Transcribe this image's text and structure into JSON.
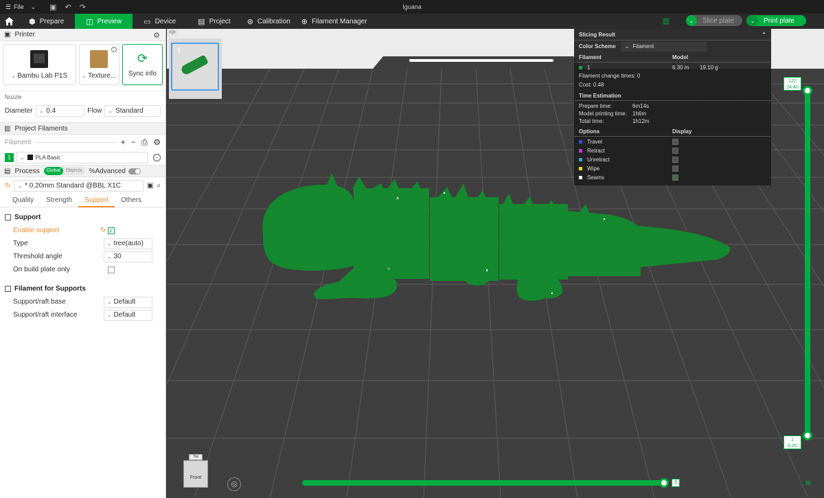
{
  "titlebar": {
    "file_label": "File",
    "title": "Iguana"
  },
  "menubar": {
    "tabs": [
      {
        "label": "Prepare"
      },
      {
        "label": "Preview"
      },
      {
        "label": "Device"
      },
      {
        "label": "Project"
      },
      {
        "label": "Calibration"
      },
      {
        "label": "Filament Manager"
      }
    ],
    "active_tab": "Preview",
    "slice_label": "Slice plate",
    "print_label": "Print plate"
  },
  "colors": {
    "accent": "#00ae42",
    "modified": "#f08c2a",
    "model": "#14892f"
  },
  "printer": {
    "section_title": "Printer",
    "printer_name": "Bambu Lab P1S",
    "plate_name": "Texture...",
    "sync_label": "Sync info",
    "nozzle_label": "Nozzle",
    "diameter_label": "Diameter",
    "diameter_value": "0.4",
    "flow_label": "Flow",
    "flow_value": "Standard"
  },
  "filaments": {
    "section_title": "Project Filaments",
    "filament_label": "Filament",
    "items": [
      {
        "index": "1",
        "name": "PLA Basic"
      }
    ]
  },
  "process": {
    "title": "Process",
    "seg_global": "Global",
    "seg_objects": "Objects",
    "advanced_label": "Advanced",
    "preset": "* 0.20mm Standard @BBL X1C",
    "tabs": [
      "Quality",
      "Strength",
      "Support",
      "Others"
    ],
    "active_tab": "Support",
    "support_group": "Support",
    "enable_support_label": "Enable support",
    "type_label": "Type",
    "type_value": "tree(auto)",
    "threshold_label": "Threshold angle",
    "threshold_value": "30",
    "build_plate_label": "On build plate only",
    "filament_group": "Filament for Supports",
    "raft_base_label": "Support/raft base",
    "raft_base_value": "Default",
    "raft_interface_label": "Support/raft interface",
    "raft_interface_value": "Default"
  },
  "plate": {
    "number": "1"
  },
  "slicing": {
    "title": "Slicing Result",
    "color_scheme_label": "Color Scheme",
    "color_scheme_value": "Filament",
    "col_filament": "Filament",
    "col_model": "Model",
    "filament_index": "1",
    "model_length": "6.30 m",
    "model_weight": "19.10 g",
    "change_times": "Filament change times:  0",
    "cost": "Cost:  0.48",
    "time_title": "Time Estimation",
    "prepare_label": "Prepare time:",
    "prepare_value": "6m14s",
    "model_time_label": "Model printing time:",
    "model_time_value": "1h6m",
    "total_label": "Total time:",
    "total_value": "1h12m",
    "options_label": "Options",
    "display_label": "Display",
    "options": [
      {
        "label": "Travel",
        "color": "#3b4fd6",
        "checked": false
      },
      {
        "label": "Retract",
        "color": "#c23bd6",
        "checked": false
      },
      {
        "label": "Unretract",
        "color": "#2fa6c8",
        "checked": false
      },
      {
        "label": "Wipe",
        "color": "#e8d81c",
        "checked": false
      },
      {
        "label": "Seams",
        "color": "#eeeeee",
        "checked": true
      }
    ]
  },
  "layers": {
    "top_layer": "122",
    "top_height": "24.40",
    "bottom_layer": "1",
    "bottom_height": "0.20",
    "move_value": "3"
  },
  "viewcube": {
    "top_label": "Top",
    "front_label": "Front"
  }
}
